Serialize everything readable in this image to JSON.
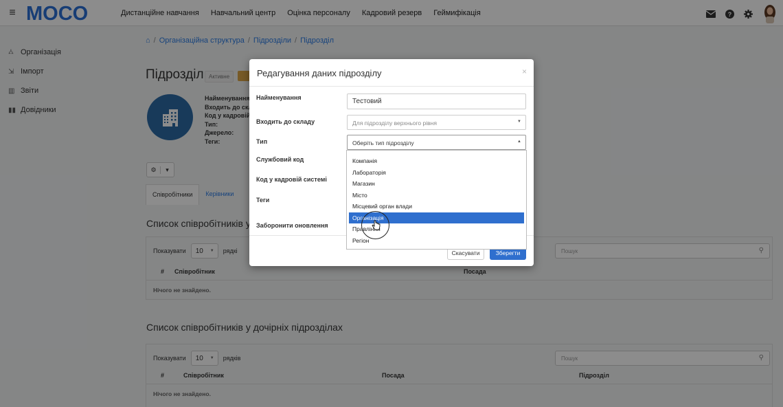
{
  "topbar": {
    "menu_icon": "hamburger-icon",
    "logo_text": "MOCO",
    "nav": [
      "Дистанційне навчання",
      "Навчальний центр",
      "Оцінка персоналу",
      "Кадровий резерв",
      "Геймифікація"
    ],
    "icons": [
      "envelope-icon",
      "help-icon",
      "gear-icon",
      "user-avatar"
    ]
  },
  "sidebar": {
    "items": [
      {
        "icon": "org-tree-icon",
        "label": "Організація"
      },
      {
        "icon": "import-icon",
        "label": "Імпорт"
      },
      {
        "icon": "chart-icon",
        "label": "Звіти"
      },
      {
        "icon": "book-icon",
        "label": "Довідники"
      }
    ]
  },
  "breadcrumb": {
    "home_icon": "home-icon",
    "items": [
      "Організаційна структура",
      "Підрозділи",
      "Підрозділ"
    ]
  },
  "page": {
    "title": "Підрозділ",
    "status_badge": "Активне",
    "info_labels": [
      "Найменування",
      "Входить до скл",
      "Код у кадровій",
      "Тип:",
      "Джерело:",
      "Теги:"
    ],
    "tabs": [
      "Співробітники",
      "Керівники"
    ]
  },
  "section1": {
    "title": "Список співробітників у п",
    "show_label": "Показувати",
    "rows_value": "10",
    "rows_label": "рядкі",
    "search_placeholder": "Пошук",
    "col_num": "#",
    "col_employee": "Співробітник",
    "col_position": "Посада",
    "empty": "Нічого не знайдено."
  },
  "section2": {
    "title": "Список співробітників у дочірніх підрозділах",
    "show_label": "Показувати",
    "rows_value": "10",
    "rows_label": "рядків",
    "search_placeholder": "Пошук",
    "col_num": "#",
    "col_employee": "Співробітник",
    "col_position": "Посада",
    "col_unit": "Підрозділ",
    "empty": "Нічого не знайдено."
  },
  "modal": {
    "title": "Редагування даних підрозділу",
    "close": "×",
    "fields": {
      "name_label": "Найменування",
      "name_value": "Тестовий",
      "parent_label": "Входить до складу",
      "parent_placeholder": "Для підрозділу верхнього рівня",
      "type_label": "Тип",
      "type_placeholder": "Оберіть тип підрозділу",
      "service_code_label": "Службовий код",
      "hr_code_label": "Код у кадровій системі",
      "tags_label": "Теги",
      "forbid_update_label": "Заборонити оновлення"
    },
    "cancel_label": "Скасувати",
    "save_label": "Зберегти"
  },
  "type_dropdown": {
    "options": [
      "Компанія",
      "Лабораторія",
      "Магазин",
      "Місто",
      "Місцевий орган влади",
      "Організація",
      "Правління",
      "Регіон"
    ],
    "highlighted": "Організація"
  },
  "colors": {
    "accent": "#2f6fce",
    "logo_blue": "#2a6fd6",
    "badge_orange": "#d9a548",
    "avatar_blue": "#2d6aa5"
  }
}
